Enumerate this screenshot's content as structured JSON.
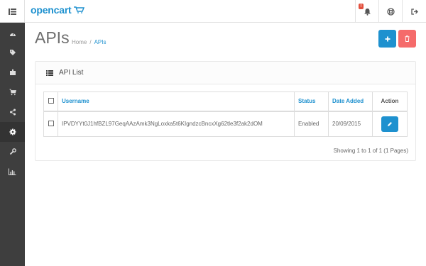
{
  "header": {
    "logo_text": "opencart",
    "notification_count": "!",
    "icons": {
      "menu": "menu-icon",
      "bell": "bell-icon",
      "help": "lifebuoy-icon",
      "logout": "logout-icon"
    }
  },
  "sidebar": {
    "items": [
      {
        "name": "dashboard",
        "icon": "dashboard-icon"
      },
      {
        "name": "catalog",
        "icon": "tags-icon"
      },
      {
        "name": "extensions",
        "icon": "puzzle-icon"
      },
      {
        "name": "sales",
        "icon": "cart-icon"
      },
      {
        "name": "marketing",
        "icon": "share-icon"
      },
      {
        "name": "system",
        "icon": "cog-icon"
      },
      {
        "name": "tools",
        "icon": "wrench-icon"
      },
      {
        "name": "reports",
        "icon": "bar-chart-icon"
      }
    ]
  },
  "page": {
    "title": "APIs",
    "breadcrumb": {
      "home": "Home",
      "separator": "/",
      "current": "APIs"
    }
  },
  "panel": {
    "title": "API List",
    "table": {
      "headers": {
        "username": "Username",
        "status": "Status",
        "date_added": "Date Added",
        "action": "Action"
      },
      "rows": [
        {
          "username": "IPVDYYt0J1hfBZL97GeqAAzAmk3NgLoxka5t6KIgndzcBncxXg62tle3f2ak2dOM",
          "status": "Enabled",
          "date_added": "20/09/2015"
        }
      ]
    },
    "pagination_text": "Showing 1 to 1 of 1 (1 Pages)"
  },
  "colors": {
    "primary": "#1e91cf",
    "danger": "#f56b6b",
    "sidebar": "#3e3e3e"
  }
}
